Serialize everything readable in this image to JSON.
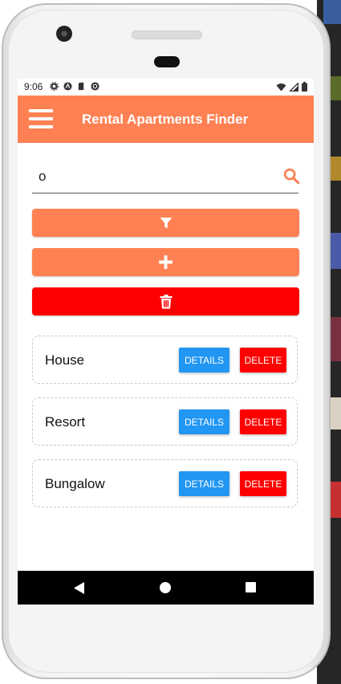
{
  "status_bar": {
    "time": "9:06"
  },
  "app_bar": {
    "title": "Rental Apartments Finder"
  },
  "search": {
    "value": "o"
  },
  "listings": [
    {
      "name": "House",
      "details_label": "DETAILS",
      "delete_label": "DELETE"
    },
    {
      "name": "Resort",
      "details_label": "DETAILS",
      "delete_label": "DELETE"
    },
    {
      "name": "Bungalow",
      "details_label": "DETAILS",
      "delete_label": "DELETE"
    }
  ],
  "colors": {
    "accent": "#ff8153",
    "danger": "#ff0000",
    "details": "#2196f3"
  }
}
